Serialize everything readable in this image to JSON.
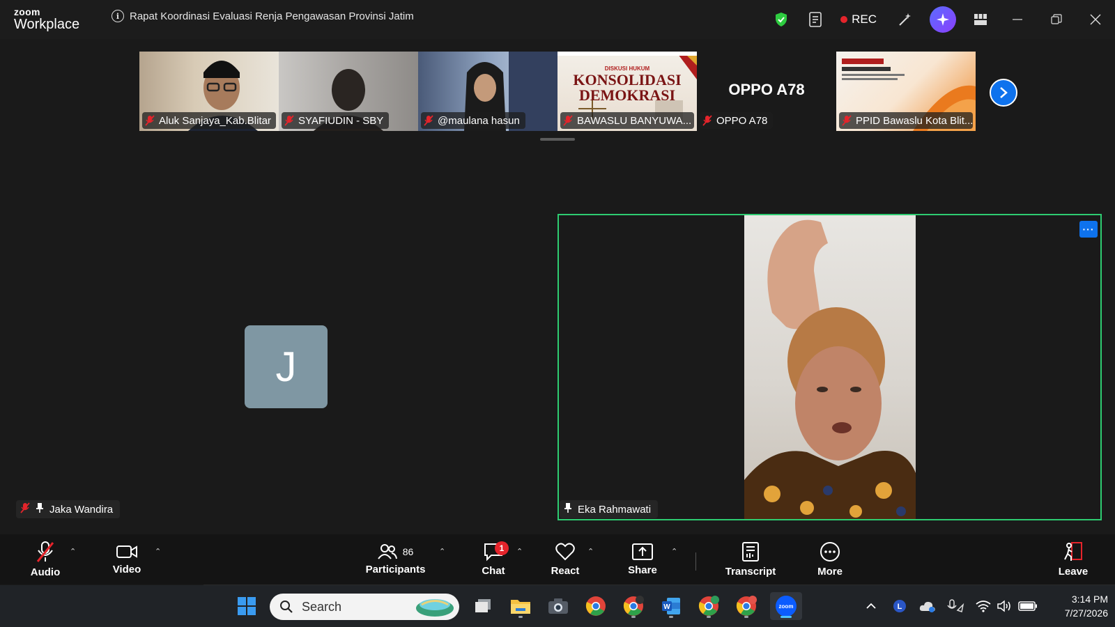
{
  "app": {
    "logo_line1": "zoom",
    "logo_line2": "Workplace",
    "meeting_title": "Rapat Koordinasi Evaluasi Renja Pengawasan Provinsi Jatim",
    "rec_label": "REC"
  },
  "thumbnails": [
    {
      "name": "Aluk Sanjaya_Kab.Blitar"
    },
    {
      "name": "SYAFIUDIN - SBY"
    },
    {
      "name": "@maulana hasun"
    },
    {
      "name": "BAWASLU BANYUWA...",
      "poster_sub": "DISKUSI HUKUM",
      "poster_text": "KONSOLIDASI DEMOKRASI"
    },
    {
      "name": "OPPO A78",
      "center_label": "OPPO A78"
    },
    {
      "name": "PPID Bawaslu Kota Blit..."
    }
  ],
  "main": {
    "left_avatar_letter": "J",
    "left_name": "Jaka Wandira",
    "right_name": "Eka Rahmawati",
    "more_dots": "···"
  },
  "toolbar": {
    "audio": "Audio",
    "video": "Video",
    "participants": "Participants",
    "participants_count": "86",
    "chat": "Chat",
    "chat_badge": "1",
    "react": "React",
    "share": "Share",
    "transcript": "Transcript",
    "more": "More",
    "leave": "Leave"
  },
  "taskbar": {
    "search_placeholder": "Search",
    "time": "3:14 PM",
    "date": "7/27/2026"
  },
  "colors": {
    "active_speaker_border": "#2ecc71",
    "accent_blue": "#0e72ed",
    "rec_red": "#e5242b",
    "avatar_bg": "#7f97a3"
  }
}
